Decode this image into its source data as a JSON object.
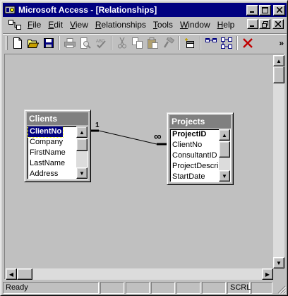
{
  "window": {
    "title": "Microsoft Access - [Relationships]"
  },
  "menubar": {
    "items": [
      {
        "label": "File"
      },
      {
        "label": "Edit"
      },
      {
        "label": "View"
      },
      {
        "label": "Relationships"
      },
      {
        "label": "Tools"
      },
      {
        "label": "Window"
      },
      {
        "label": "Help"
      }
    ]
  },
  "toolbar": {
    "buttons": [
      "new-icon",
      "open-icon",
      "save-icon",
      "print-icon",
      "print-preview-icon",
      "spelling-icon",
      "cut-icon",
      "copy-icon",
      "paste-icon",
      "format-painter-icon",
      "show-table-icon",
      "show-direct-icon",
      "show-all-icon",
      "delete-icon"
    ],
    "overflow_label": "»"
  },
  "tables": {
    "clients": {
      "title": "Clients",
      "fields": [
        "ClientNo",
        "Company",
        "FirstName",
        "LastName",
        "Address"
      ],
      "selected_field": "ClientNo"
    },
    "projects": {
      "title": "Projects",
      "fields": [
        "ProjectID",
        "ClientNo",
        "ConsultantID",
        "ProjectDescrip",
        "StartDate"
      ],
      "key_field": "ProjectID"
    }
  },
  "relationship": {
    "one_label": "1",
    "many_label": "∞"
  },
  "statusbar": {
    "status_text": "Ready",
    "scrl_label": "SCRL"
  },
  "colors": {
    "titlebar": "#000080",
    "inactive_table_title": "#808080",
    "face": "#c0c0c0",
    "delete_red": "#c00000"
  }
}
